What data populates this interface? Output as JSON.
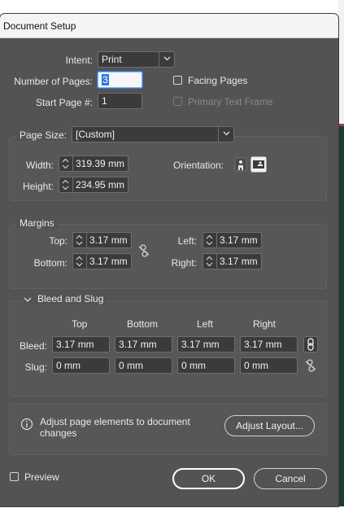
{
  "window": {
    "title": "Document Setup"
  },
  "intent": {
    "label": "Intent:",
    "value": "Print"
  },
  "pages": {
    "number_label": "Number of Pages:",
    "number_value": "3",
    "start_label": "Start Page #:",
    "start_value": "1",
    "facing_pages_label": "Facing Pages",
    "facing_pages_checked": false,
    "primary_text_frame_label": "Primary Text Frame",
    "primary_text_frame_checked": false
  },
  "page_size": {
    "label": "Page Size:",
    "value": "[Custom]",
    "width_label": "Width:",
    "width_value": "319.39 mm",
    "height_label": "Height:",
    "height_value": "234.95 mm",
    "orientation_label": "Orientation:",
    "orientation_selected": "landscape"
  },
  "margins": {
    "title": "Margins",
    "top_label": "Top:",
    "top_value": "3.17 mm",
    "bottom_label": "Bottom:",
    "bottom_value": "3.17 mm",
    "left_label": "Left:",
    "left_value": "3.17 mm",
    "right_label": "Right:",
    "right_value": "3.17 mm",
    "linked": false
  },
  "bleed_slug": {
    "title": "Bleed and Slug",
    "columns": [
      "Top",
      "Bottom",
      "Left",
      "Right"
    ],
    "bleed_label": "Bleed:",
    "bleed_values": [
      "3.17 mm",
      "3.17 mm",
      "3.17 mm",
      "3.17 mm"
    ],
    "bleed_linked": true,
    "slug_label": "Slug:",
    "slug_values": [
      "0 mm",
      "0 mm",
      "0 mm",
      "0 mm"
    ],
    "slug_linked": false
  },
  "info": {
    "icon": "info-icon",
    "text_line1": "Adjust page elements to document",
    "text_line2": "changes",
    "adjust_button": "Adjust Layout..."
  },
  "footer": {
    "preview_label": "Preview",
    "preview_checked": false,
    "ok_label": "OK",
    "cancel_label": "Cancel"
  },
  "colors": {
    "dialog_bg": "#535353",
    "field_bg": "#3b3b3b",
    "focus": "#2b78e4"
  }
}
